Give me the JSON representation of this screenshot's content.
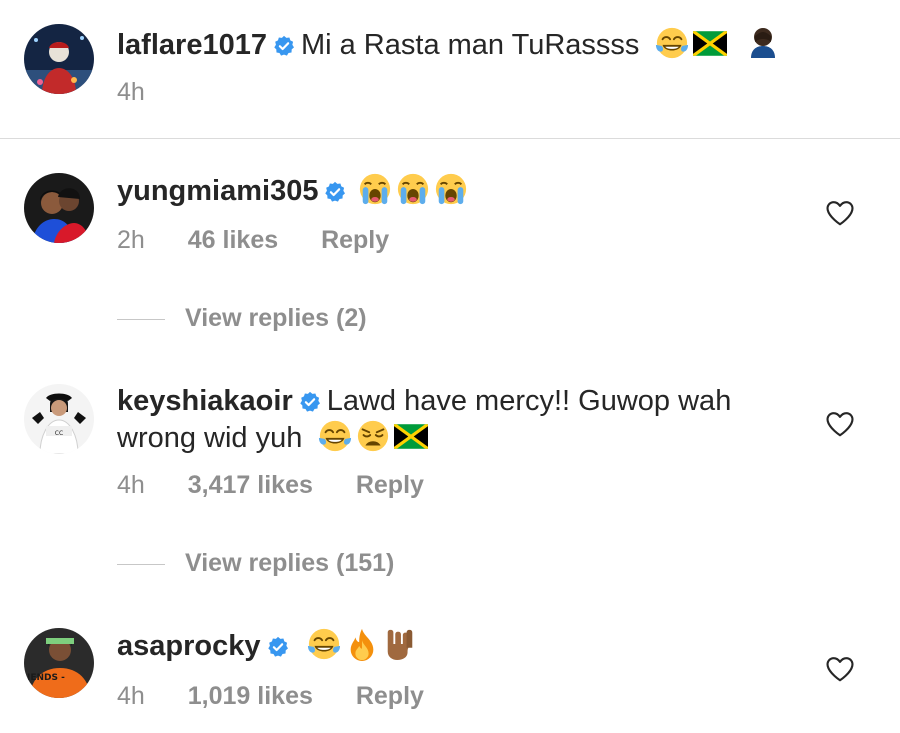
{
  "comments": [
    {
      "username": "laflare1017",
      "verified": true,
      "text": "Mi a Rasta man TuRassss",
      "emojis": [
        "face-with-tears-of-joy-icon",
        "jamaica-flag-icon",
        "facepalm-icon"
      ],
      "time": "4h"
    },
    {
      "username": "yungmiami305",
      "verified": true,
      "text": "",
      "emojis": [
        "loudly-crying-face-icon",
        "loudly-crying-face-icon",
        "loudly-crying-face-icon"
      ],
      "time": "2h",
      "likes": "46 likes",
      "reply_label": "Reply",
      "view_replies": "View replies (2)"
    },
    {
      "username": "keyshiakaoir",
      "verified": true,
      "text_line1": "Lawd have mercy!! Guwop wah",
      "text_line2": "wrong wid yuh",
      "emojis": [
        "face-with-tears-of-joy-icon",
        "weary-face-icon",
        "jamaica-flag-icon"
      ],
      "time": "4h",
      "likes": "3,417 likes",
      "reply_label": "Reply",
      "view_replies": "View replies (151)"
    },
    {
      "username": "asaprocky",
      "verified": true,
      "text": "",
      "emojis": [
        "face-with-tears-of-joy-icon",
        "fire-icon",
        "sign-of-the-horns-icon"
      ],
      "time": "4h",
      "likes": "1,019 likes",
      "reply_label": "Reply",
      "avatar_caption": "IENDS -"
    }
  ],
  "colors": {
    "text_primary": "#262626",
    "text_secondary": "#8e8e8e",
    "verified_blue": "#3897f0",
    "divider": "#dbdbdb"
  }
}
